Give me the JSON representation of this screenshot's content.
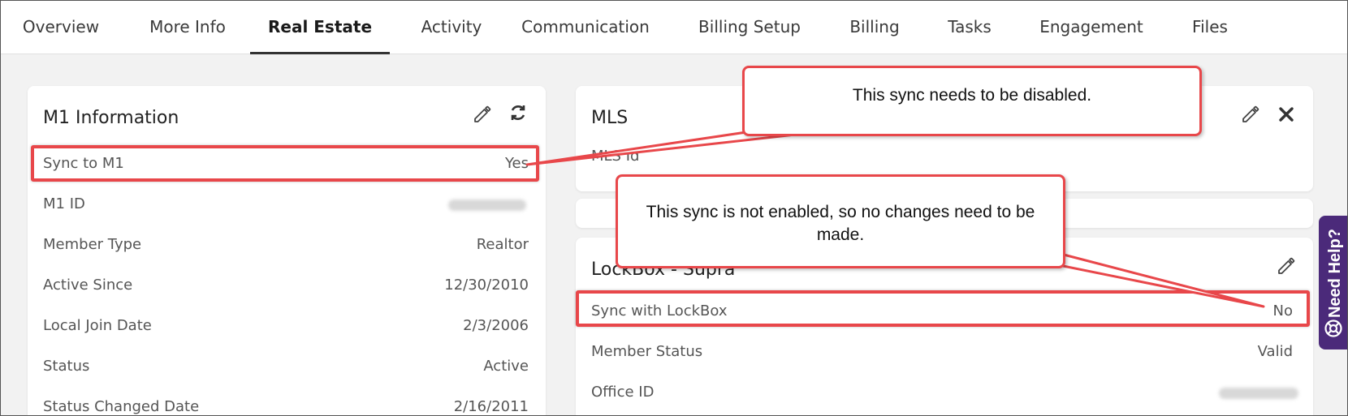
{
  "tabs": [
    {
      "label": "Overview"
    },
    {
      "label": "More Info"
    },
    {
      "label": "Real Estate"
    },
    {
      "label": "Activity"
    },
    {
      "label": "Communication"
    },
    {
      "label": "Billing Setup"
    },
    {
      "label": "Billing"
    },
    {
      "label": "Tasks"
    },
    {
      "label": "Engagement"
    },
    {
      "label": "Files"
    }
  ],
  "active_tab": "Real Estate",
  "m1_card": {
    "title": "M1 Information",
    "rows": [
      {
        "label": "Sync to M1",
        "value": "Yes"
      },
      {
        "label": "M1 ID",
        "value": ""
      },
      {
        "label": "Member Type",
        "value": "Realtor"
      },
      {
        "label": "Active Since",
        "value": "12/30/2010"
      },
      {
        "label": "Local Join Date",
        "value": "2/3/2006"
      },
      {
        "label": "Status",
        "value": "Active"
      },
      {
        "label": "Status Changed Date",
        "value": "2/16/2011"
      }
    ],
    "icons": [
      "pencil-icon",
      "refresh-icon"
    ]
  },
  "mls_card": {
    "title": "MLS",
    "rows": [
      {
        "label": "MLS Id",
        "value": ""
      }
    ],
    "icons": [
      "pencil-icon",
      "close-icon"
    ]
  },
  "lockbox_card": {
    "title": "LockBox - Supra",
    "rows": [
      {
        "label": "Sync with LockBox",
        "value": "No"
      },
      {
        "label": "Member Status",
        "value": "Valid"
      },
      {
        "label": "Office ID",
        "value": ""
      }
    ],
    "icons": [
      "pencil-icon"
    ]
  },
  "callouts": {
    "top": "This sync needs to be disabled.",
    "bottom": "This sync is not enabled, so no changes need to be made."
  },
  "help": {
    "label": "Need Help?",
    "icon": "lifebuoy-icon"
  },
  "colors": {
    "highlight": "#e8474a",
    "help_bg": "#4b2a7a"
  }
}
